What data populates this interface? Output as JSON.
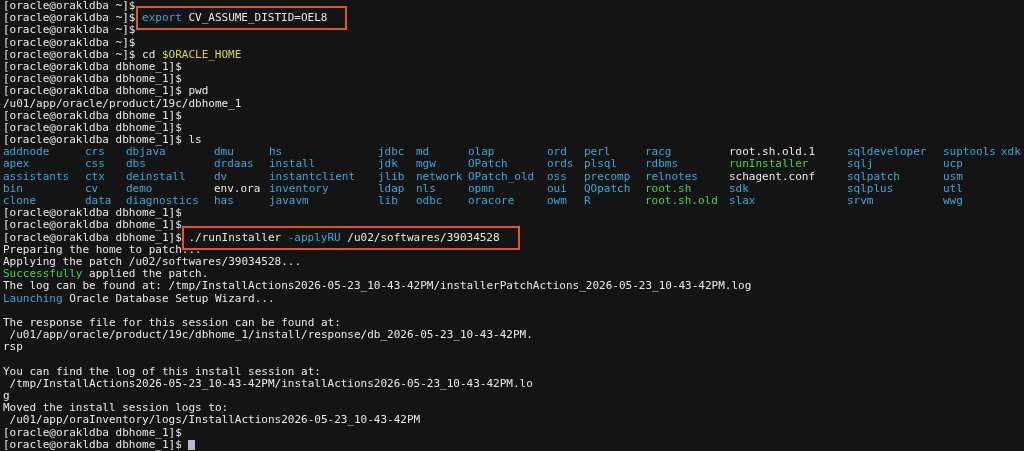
{
  "terminal": {
    "lines": [
      {
        "kind": "text",
        "segments": [
          {
            "kind": "prompt",
            "text": "[oracle@orakldba ~]$"
          }
        ]
      },
      {
        "kind": "text",
        "segments": [
          {
            "kind": "prompt",
            "text": "[oracle@orakldba ~]$"
          }
        ],
        "highlighted": true,
        "command": [
          {
            "kind": "keyword",
            "text": "export"
          },
          {
            "kind": "plain",
            "text": "CV_ASSUME_DISTID=OEL8"
          }
        ]
      },
      {
        "kind": "text",
        "segments": [
          {
            "kind": "prompt",
            "text": "[oracle@orakldba ~]$"
          }
        ]
      },
      {
        "kind": "text",
        "segments": [
          {
            "kind": "prompt",
            "text": "[oracle@orakldba ~]$"
          }
        ]
      },
      {
        "kind": "text",
        "segments": [
          {
            "kind": "prompt",
            "text": "[oracle@orakldba ~]$"
          },
          {
            "kind": "plain",
            "text": "cd"
          },
          {
            "kind": "variable",
            "text": "$ORACLE_HOME"
          }
        ]
      },
      {
        "kind": "text",
        "segments": [
          {
            "kind": "prompt",
            "text": "[oracle@orakldba dbhome_1]$"
          }
        ]
      },
      {
        "kind": "text",
        "segments": [
          {
            "kind": "prompt",
            "text": "[oracle@orakldba dbhome_1]$"
          }
        ]
      },
      {
        "kind": "text",
        "segments": [
          {
            "kind": "prompt",
            "text": "[oracle@orakldba dbhome_1]$"
          },
          {
            "kind": "plain",
            "text": "pwd"
          }
        ]
      },
      {
        "kind": "text",
        "segments": [
          {
            "kind": "output",
            "text": "/u01/app/oracle/product/19c/dbhome_1"
          }
        ]
      },
      {
        "kind": "text",
        "segments": [
          {
            "kind": "prompt",
            "text": "[oracle@orakldba dbhome_1]$"
          }
        ]
      },
      {
        "kind": "text",
        "segments": [
          {
            "kind": "prompt",
            "text": "[oracle@orakldba dbhome_1]$"
          }
        ]
      },
      {
        "kind": "text",
        "segments": [
          {
            "kind": "prompt",
            "text": "[oracle@orakldba dbhome_1]$"
          },
          {
            "kind": "plain",
            "text": "ls"
          }
        ]
      },
      {
        "kind": "listing",
        "rows": [
          [
            {
              "kind": "dir",
              "text": "addnode"
            },
            {
              "kind": "dir",
              "text": "crs"
            },
            {
              "kind": "dir",
              "text": "dbjava"
            },
            {
              "kind": "dir",
              "text": "dmu"
            },
            {
              "kind": "dir",
              "text": "hs"
            },
            {
              "kind": "dir",
              "text": "jdbc"
            },
            {
              "kind": "dir",
              "text": "md"
            },
            {
              "kind": "dir",
              "text": "olap"
            },
            {
              "kind": "dir",
              "text": "ord"
            },
            {
              "kind": "dir",
              "text": "perl"
            },
            {
              "kind": "dir",
              "text": "racg"
            },
            {
              "kind": "file",
              "text": "root.sh.old.1"
            },
            {
              "kind": "dir",
              "text": "sqldeveloper"
            },
            {
              "kind": "dir",
              "text": "suptools"
            },
            {
              "kind": "dir",
              "text": "xdk"
            }
          ],
          [
            {
              "kind": "dir",
              "text": "apex"
            },
            {
              "kind": "dir",
              "text": "css"
            },
            {
              "kind": "dir",
              "text": "dbs"
            },
            {
              "kind": "dir",
              "text": "drdaas"
            },
            {
              "kind": "dir",
              "text": "install"
            },
            {
              "kind": "dir",
              "text": "jdk"
            },
            {
              "kind": "dir",
              "text": "mgw"
            },
            {
              "kind": "dir",
              "text": "OPatch"
            },
            {
              "kind": "dir",
              "text": "ords"
            },
            {
              "kind": "dir",
              "text": "plsql"
            },
            {
              "kind": "dir",
              "text": "rdbms"
            },
            {
              "kind": "exec",
              "text": "runInstaller"
            },
            {
              "kind": "dir",
              "text": "sqlj"
            },
            {
              "kind": "dir",
              "text": "ucp"
            }
          ],
          [
            {
              "kind": "dir",
              "text": "assistants"
            },
            {
              "kind": "dir",
              "text": "ctx"
            },
            {
              "kind": "dir",
              "text": "deinstall"
            },
            {
              "kind": "dir",
              "text": "dv"
            },
            {
              "kind": "dir",
              "text": "instantclient"
            },
            {
              "kind": "dir",
              "text": "jlib"
            },
            {
              "kind": "dir",
              "text": "network"
            },
            {
              "kind": "dir",
              "text": "OPatch_old"
            },
            {
              "kind": "dir",
              "text": "oss"
            },
            {
              "kind": "dir",
              "text": "precomp"
            },
            {
              "kind": "dir",
              "text": "relnotes"
            },
            {
              "kind": "file",
              "text": "schagent.conf"
            },
            {
              "kind": "dir",
              "text": "sqlpatch"
            },
            {
              "kind": "dir",
              "text": "usm"
            }
          ],
          [
            {
              "kind": "dir",
              "text": "bin"
            },
            {
              "kind": "dir",
              "text": "cv"
            },
            {
              "kind": "dir",
              "text": "demo"
            },
            {
              "kind": "file",
              "text": "env.ora"
            },
            {
              "kind": "dir",
              "text": "inventory"
            },
            {
              "kind": "dir",
              "text": "ldap"
            },
            {
              "kind": "dir",
              "text": "nls"
            },
            {
              "kind": "dir",
              "text": "opmn"
            },
            {
              "kind": "dir",
              "text": "oui"
            },
            {
              "kind": "dir",
              "text": "QOpatch"
            },
            {
              "kind": "exec",
              "text": "root.sh"
            },
            {
              "kind": "dir",
              "text": "sdk"
            },
            {
              "kind": "dir",
              "text": "sqlplus"
            },
            {
              "kind": "dir",
              "text": "utl"
            }
          ],
          [
            {
              "kind": "dir",
              "text": "clone"
            },
            {
              "kind": "dir",
              "text": "data"
            },
            {
              "kind": "dir",
              "text": "diagnostics"
            },
            {
              "kind": "dir",
              "text": "has"
            },
            {
              "kind": "dir",
              "text": "javavm"
            },
            {
              "kind": "dir",
              "text": "lib"
            },
            {
              "kind": "dir",
              "text": "odbc"
            },
            {
              "kind": "dir",
              "text": "oracore"
            },
            {
              "kind": "dir",
              "text": "owm"
            },
            {
              "kind": "dir",
              "text": "R"
            },
            {
              "kind": "exec",
              "text": "root.sh.old"
            },
            {
              "kind": "dir",
              "text": "slax"
            },
            {
              "kind": "dir",
              "text": "srvm"
            },
            {
              "kind": "dir",
              "text": "wwg"
            }
          ]
        ]
      },
      {
        "kind": "text",
        "segments": [
          {
            "kind": "prompt",
            "text": "[oracle@orakldba dbhome_1]$"
          }
        ]
      },
      {
        "kind": "text",
        "segments": [
          {
            "kind": "prompt",
            "text": "[oracle@orakldba dbhome_1]$"
          }
        ]
      },
      {
        "kind": "text",
        "segments": [
          {
            "kind": "prompt",
            "text": "[oracle@orakldba dbhome_1]$"
          }
        ],
        "highlighted": true,
        "command": [
          {
            "kind": "plain",
            "text": "./runInstaller"
          },
          {
            "kind": "keyword",
            "text": "-applyRU"
          },
          {
            "kind": "plain",
            "text": "/u02/softwares/39034528"
          }
        ]
      },
      {
        "kind": "text",
        "segments": [
          {
            "kind": "output",
            "text": "Preparing the home to patch..."
          }
        ]
      },
      {
        "kind": "text",
        "segments": [
          {
            "kind": "output",
            "text": "Applying the patch /u02/softwares/39034528..."
          }
        ]
      },
      {
        "kind": "text",
        "segments": [
          {
            "kind": "success",
            "text": "Successfully"
          },
          {
            "kind": "output",
            "text": "applied the patch."
          }
        ]
      },
      {
        "kind": "text",
        "segments": [
          {
            "kind": "output",
            "text": "The log can be found at: /tmp/InstallActions2026-05-23_10-43-42PM/installerPatchActions_2026-05-23_10-43-42PM.log"
          }
        ]
      },
      {
        "kind": "text",
        "segments": [
          {
            "kind": "info",
            "text": "Launching"
          },
          {
            "kind": "output",
            "text": "Oracle Database Setup Wizard..."
          }
        ]
      },
      {
        "kind": "blank"
      },
      {
        "kind": "text",
        "segments": [
          {
            "kind": "output",
            "text": "The response file for this session can be found at:"
          }
        ]
      },
      {
        "kind": "text",
        "segments": [
          {
            "kind": "output",
            "text": " /u01/app/oracle/product/19c/dbhome_1/install/response/db_2026-05-23_10-43-42PM."
          }
        ]
      },
      {
        "kind": "text",
        "segments": [
          {
            "kind": "output",
            "text": "rsp"
          }
        ]
      },
      {
        "kind": "blank"
      },
      {
        "kind": "text",
        "segments": [
          {
            "kind": "output",
            "text": "You can find the log of this install session at:"
          }
        ]
      },
      {
        "kind": "text",
        "segments": [
          {
            "kind": "output",
            "text": " /tmp/InstallActions2026-05-23_10-43-42PM/installActions2026-05-23_10-43-42PM.lo"
          }
        ]
      },
      {
        "kind": "text",
        "segments": [
          {
            "kind": "output",
            "text": "g"
          }
        ]
      },
      {
        "kind": "text",
        "segments": [
          {
            "kind": "output",
            "text": "Moved the install session logs to:"
          }
        ]
      },
      {
        "kind": "text",
        "segments": [
          {
            "kind": "output",
            "text": " /u01/app/oraInventory/logs/InstallActions2026-05-23_10-43-42PM"
          }
        ]
      },
      {
        "kind": "text",
        "segments": [
          {
            "kind": "prompt",
            "text": "[oracle@orakldba dbhome_1]$"
          }
        ]
      },
      {
        "kind": "text",
        "segments": [
          {
            "kind": "prompt",
            "text": "[oracle@orakldba dbhome_1]$"
          }
        ],
        "cursor": true
      }
    ]
  }
}
